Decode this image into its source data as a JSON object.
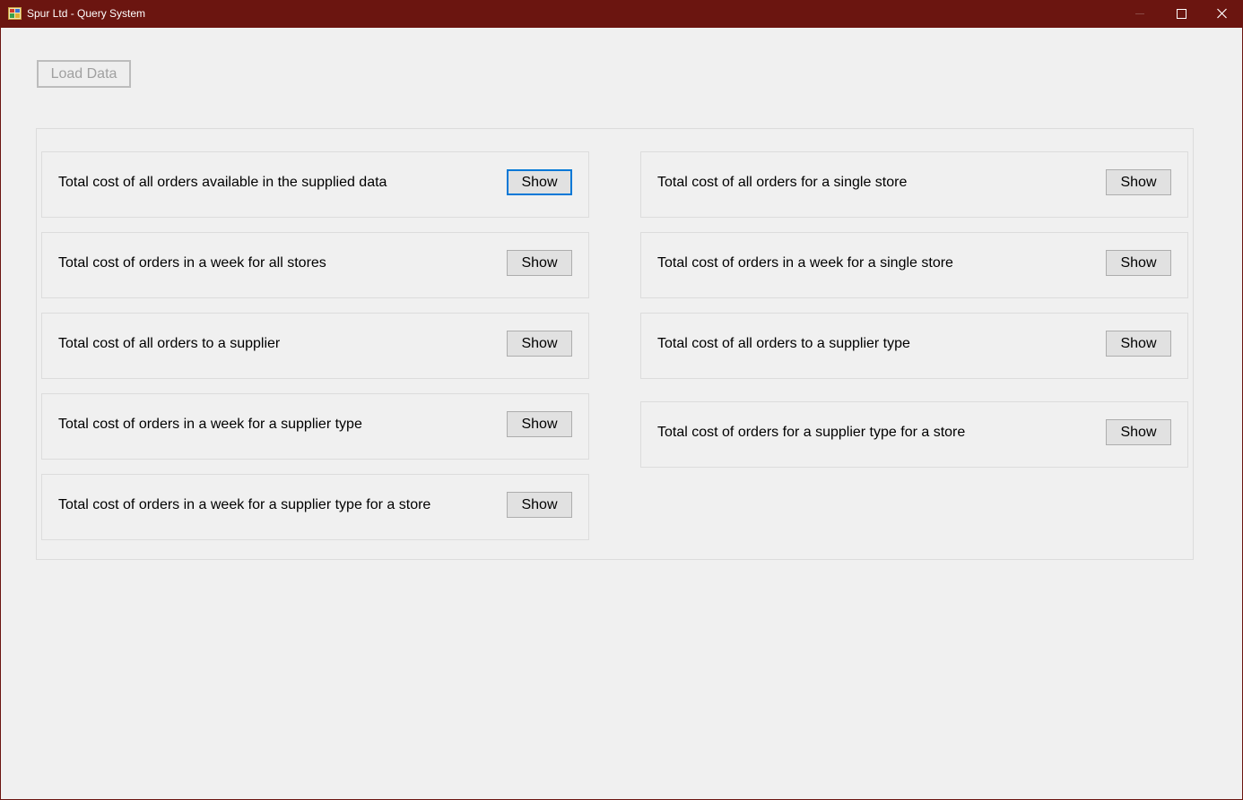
{
  "window": {
    "title": "Spur Ltd - Query System",
    "accent_color": "#6b1510",
    "controls": [
      "minimize-icon",
      "maximize-icon",
      "close-icon"
    ]
  },
  "toolbar": {
    "load_label": "Load Data"
  },
  "queries": {
    "left": [
      {
        "label": "Total cost of all orders available in the supplied data",
        "button": "Show"
      },
      {
        "label": "Total cost of orders in a week for all stores",
        "button": "Show"
      },
      {
        "label": "Total cost of all orders to a supplier",
        "button": "Show"
      },
      {
        "label": "Total cost of orders in a week for a supplier type",
        "button": "Show"
      },
      {
        "label": "Total cost of orders in a week for a supplier type for a store",
        "button": "Show"
      }
    ],
    "right": [
      {
        "label": "Total cost of all orders for a single store",
        "button": "Show"
      },
      {
        "label": "Total cost of orders in a week for a single store",
        "button": "Show"
      },
      {
        "label": "Total cost of all orders to a supplier type",
        "button": "Show"
      },
      {
        "label": "Total cost of orders for a supplier type for a store",
        "button": "Show"
      }
    ]
  }
}
